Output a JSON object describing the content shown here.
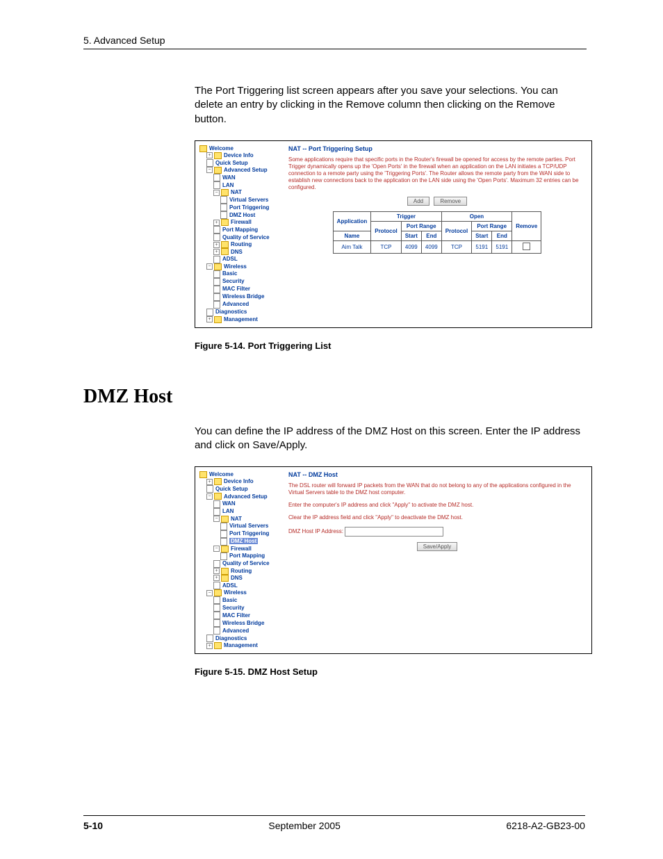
{
  "chapter_header": "5. Advanced Setup",
  "intro_p1": "The Port Triggering list screen appears after you save your selections. You can delete an entry by clicking in the Remove column then clicking on the Remove button.",
  "fig1": {
    "title": "NAT -- Port Triggering Setup",
    "desc": "Some applications require that specific ports in the Router's firewall be opened for access by the remote parties. Port Trigger dynamically opens up the 'Open Ports' in the firewall when an application on the LAN initiates a TCP/UDP connection to a remote party using the 'Triggering Ports'. The Router allows the remote party from the WAN side to establish new connections back to the application on the LAN side using the 'Open Ports'. Maximum 32 entries can be configured.",
    "btn_add": "Add",
    "btn_remove": "Remove",
    "table": {
      "h_application": "Application",
      "h_trigger": "Trigger",
      "h_open": "Open",
      "h_remove": "Remove",
      "h_name": "Name",
      "h_protocol": "Protocol",
      "h_portrange": "Port Range",
      "h_start": "Start",
      "h_end": "End",
      "row": {
        "name": "Aim Talk",
        "t_proto": "TCP",
        "t_start": "4099",
        "t_end": "4099",
        "o_proto": "TCP",
        "o_start": "5191",
        "o_end": "5191"
      }
    },
    "caption": "Figure 5-14.   Port Triggering List"
  },
  "dmz": {
    "heading": "DMZ Host",
    "intro": "You can define the IP address of the DMZ Host on this screen. Enter the IP address and click on Save/Apply."
  },
  "fig2": {
    "title": "NAT -- DMZ Host",
    "line1": "The DSL router will forward IP packets from the WAN that do not belong to any of the applications configured in the Virtual Servers table to the DMZ host computer.",
    "line2": "Enter the computer's IP address and click \"Apply\" to activate the DMZ host.",
    "line3": "Clear the IP address field and click \"Apply\" to deactivate the DMZ host.",
    "label": "DMZ Host IP Address:",
    "btn": "Save/Apply",
    "caption": "Figure 5-15.   DMZ Host Setup"
  },
  "tree": {
    "welcome": "Welcome",
    "device_info": "Device Info",
    "quick_setup": "Quick Setup",
    "advanced_setup": "Advanced Setup",
    "wan": "WAN",
    "lan": "LAN",
    "nat": "NAT",
    "virtual_servers": "Virtual Servers",
    "port_triggering": "Port Triggering",
    "dmz_host": "DMZ Host",
    "firewall": "Firewall",
    "port_mapping": "Port Mapping",
    "qos": "Quality of Service",
    "routing": "Routing",
    "dns": "DNS",
    "adsl": "ADSL",
    "wireless": "Wireless",
    "basic": "Basic",
    "security": "Security",
    "mac_filter": "MAC Filter",
    "wireless_bridge": "Wireless Bridge",
    "advanced": "Advanced",
    "diagnostics": "Diagnostics",
    "management": "Management"
  },
  "footer": {
    "page": "5-10",
    "center": "September 2005",
    "right": "6218-A2-GB23-00"
  }
}
